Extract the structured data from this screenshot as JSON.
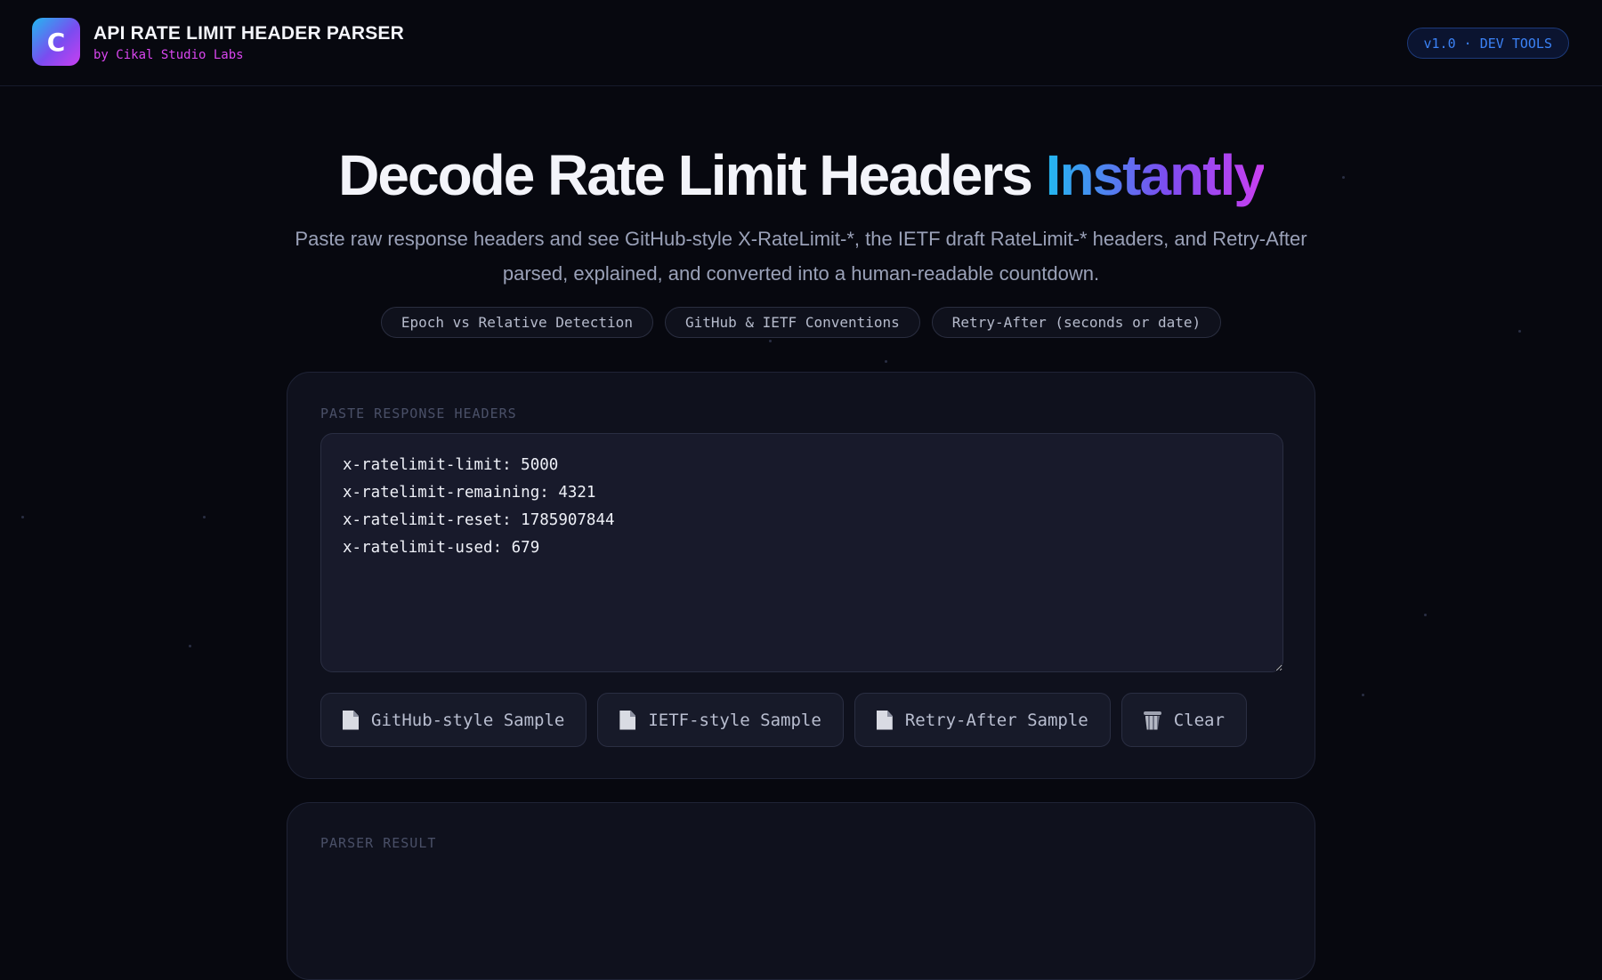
{
  "header": {
    "logo_letter": "C",
    "title": "API RATE LIMIT HEADER PARSER",
    "subtitle": "by Cikal Studio Labs",
    "badge": "v1.0 · DEV TOOLS"
  },
  "hero": {
    "title_main": "Decode Rate Limit Headers ",
    "title_accent": "Instantly",
    "description": "Paste raw response headers and see GitHub-style X-RateLimit-*, the IETF draft RateLimit-* headers, and Retry-After parsed, explained, and converted into a human-readable countdown.",
    "chips": [
      "Epoch vs Relative Detection",
      "GitHub & IETF Conventions",
      "Retry-After (seconds or date)"
    ]
  },
  "input_card": {
    "label": "PASTE RESPONSE HEADERS",
    "textarea_value": "x-ratelimit-limit: 5000\nx-ratelimit-remaining: 4321\nx-ratelimit-reset: 1785907844\nx-ratelimit-used: 679",
    "buttons": {
      "github_sample": "GitHub-style Sample",
      "ietf_sample": "IETF-style Sample",
      "retry_sample": "Retry-After Sample",
      "clear": "Clear"
    }
  },
  "result_card": {
    "label": "PARSER RESULT"
  },
  "colors": {
    "background": "#07080f",
    "accent_magenta": "#d946ef",
    "accent_blue": "#3b82f6",
    "gradient_start": "#22b8f0",
    "gradient_end": "#c93ff0"
  },
  "icons": {
    "sample_button_icon": "document-icon",
    "clear_button_icon": "trash-icon"
  }
}
